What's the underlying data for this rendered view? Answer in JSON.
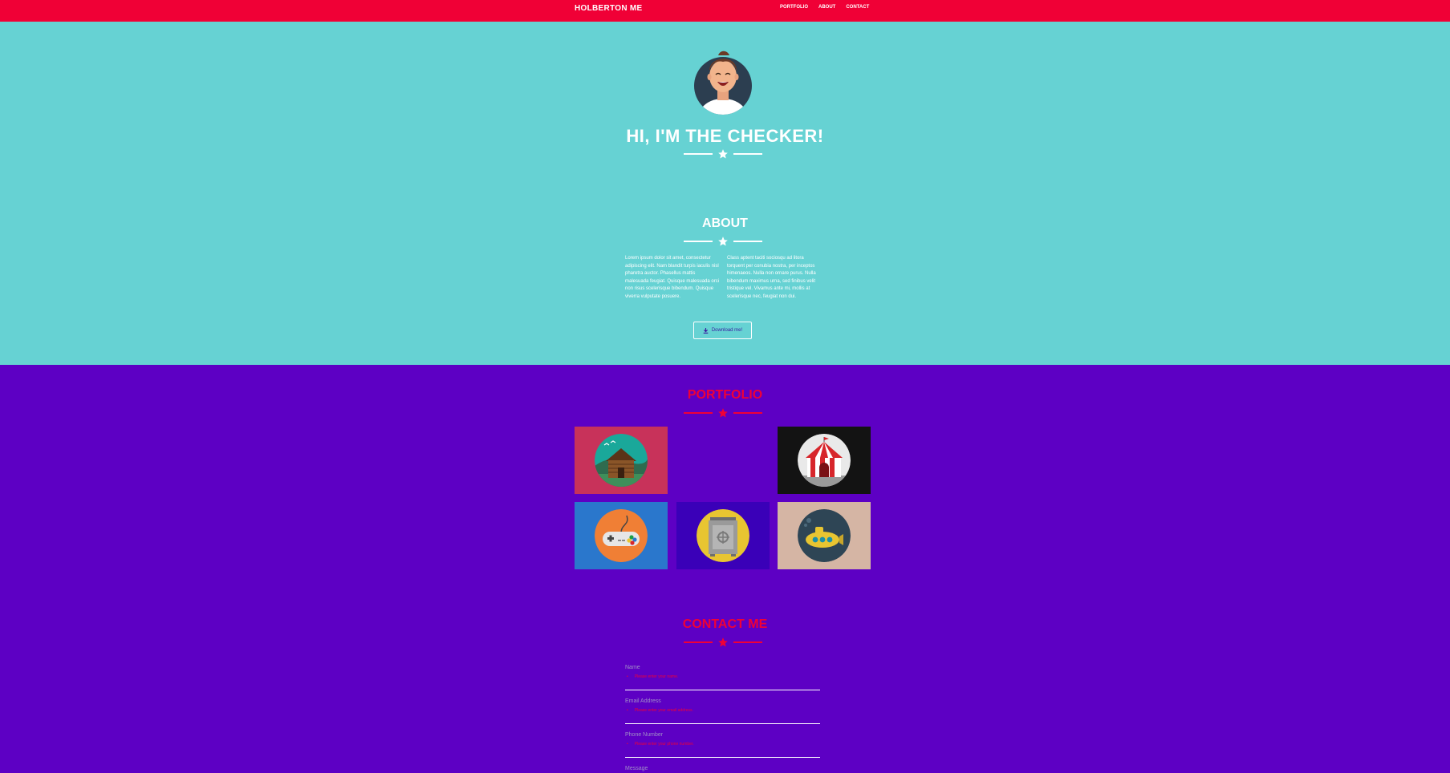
{
  "nav": {
    "brand": "HOLBERTON ME",
    "links": [
      "PORTFOLIO",
      "ABOUT",
      "CONTACT"
    ]
  },
  "header": {
    "title": "HI, I'M THE CHECKER!"
  },
  "about": {
    "title": "ABOUT",
    "col1": "Lorem ipsum dolor sit amet, consectetur adipiscing elit. Nam blandit turpis iaculis nisl pharetra auctor. Phasellus mattis malesuada feugiat. Quisque malesuada orci non risus scelerisque bibendum. Quisque viverra vulputate posuere.",
    "col2": "Class aptent taciti sociosqu ad litora torquent per conubia nostra, per inceptos himenaeos. Nulla non ornare purus. Nulla bibendum maximus urna, sed finibus velit tristique vel. Vivamus ante mi, mollis at scelerisque nec, feugiat non dui.",
    "download_label": "Download me!"
  },
  "portfolio": {
    "title": "PORTFOLIO",
    "items": [
      {
        "name": "cabin",
        "bg": "#c8325a"
      },
      {
        "name": "empty",
        "bg": "#5d00c4"
      },
      {
        "name": "circus-tent",
        "bg": "#131313"
      },
      {
        "name": "game-controller",
        "bg": "#2a77cc"
      },
      {
        "name": "safe",
        "bg": "#3a00b8"
      },
      {
        "name": "submarine",
        "bg": "#d5b5a4"
      }
    ]
  },
  "contact": {
    "title": "CONTACT ME",
    "fields": [
      {
        "label": "Name",
        "error": "Please enter your name."
      },
      {
        "label": "Email Address",
        "error": "Please enter your email address."
      },
      {
        "label": "Phone Number",
        "error": "Please enter your phone number."
      }
    ],
    "message_label": "Message"
  },
  "colors": {
    "nav": "#f00036",
    "header": "#66d2d3",
    "body": "#5d00c4",
    "accent": "#f00036"
  }
}
